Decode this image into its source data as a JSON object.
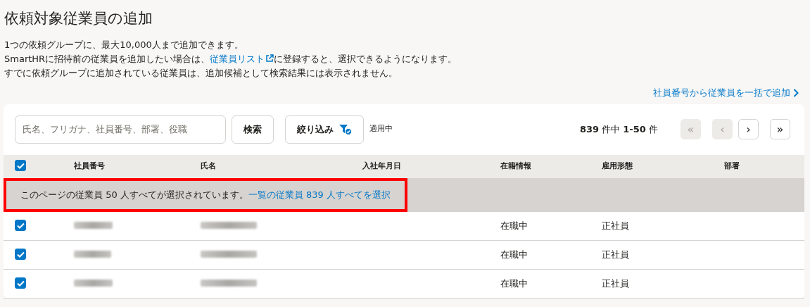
{
  "title": "依頼対象従業員の追加",
  "description": [
    {
      "text": "1つの依頼グループに、最大10,000人まで追加できます。"
    },
    {
      "before": "SmartHRに招待前の従業員を追加したい場合は、",
      "link": "従業員リスト",
      "after": "に登録すると、選択できるようになります。"
    },
    {
      "text": "すでに依頼グループに追加されている従業員は、追加候補として検索結果には表示されません。"
    }
  ],
  "bulk_add_link": "社員番号から従業員を一括で追加",
  "search": {
    "placeholder": "氏名、フリガナ、社員番号、部署、役職",
    "button": "検索"
  },
  "filter": {
    "label": "絞り込み",
    "active": true,
    "status": "適用中"
  },
  "pagination": {
    "total": "839",
    "total_unit": "件中",
    "range": "1-50",
    "range_unit": "件",
    "buttons": [
      {
        "label": "«",
        "disabled": true
      },
      {
        "label": "‹",
        "disabled": true
      },
      {
        "label": "›",
        "disabled": false
      },
      {
        "label": "»",
        "disabled": false
      }
    ]
  },
  "table": {
    "select_all_checked": true,
    "columns": [
      "社員番号",
      "氏名",
      "入社年月日",
      "在籍情報",
      "雇用形態",
      "部署"
    ],
    "selection_banner": {
      "text": "このページの従業員 50 人すべてが選択されています。",
      "link": "一覧の従業員 839 人すべてを選択",
      "highlighted": true
    },
    "rows": [
      {
        "checked": true,
        "status": "在職中",
        "employment_type": "正社員"
      },
      {
        "checked": true,
        "status": "在職中",
        "employment_type": "正社員"
      },
      {
        "checked": true,
        "status": "在職中",
        "employment_type": "正社員"
      }
    ]
  }
}
